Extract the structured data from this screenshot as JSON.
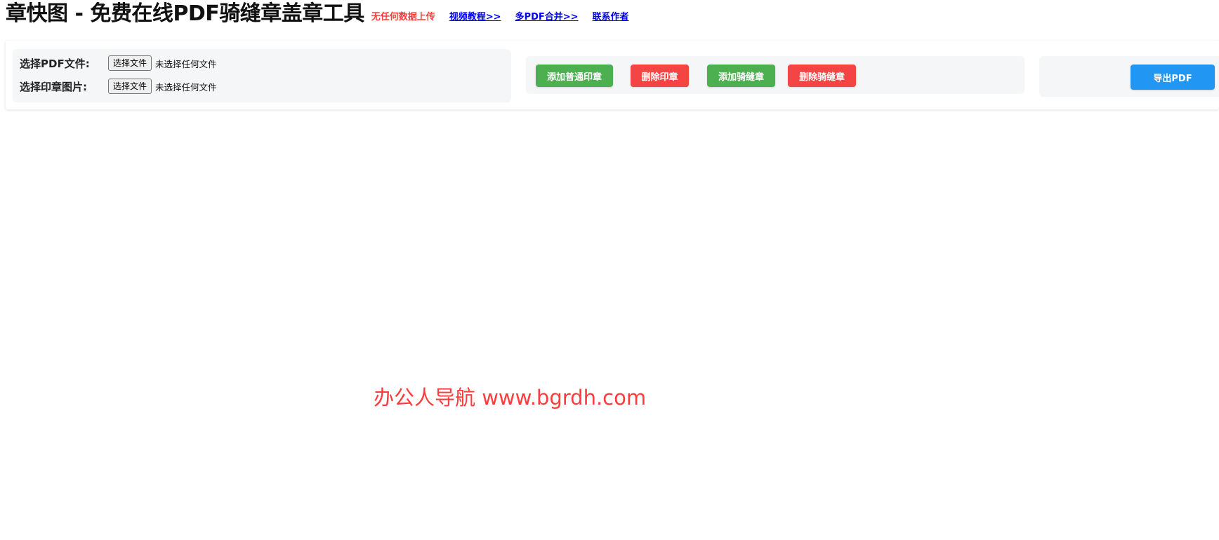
{
  "header": {
    "title": "章快图 - 免费在线PDF骑缝章盖章工具",
    "privacy_note": "无任何数据上传",
    "links": [
      {
        "label": "视频教程>>"
      },
      {
        "label": "多PDF合并>>"
      },
      {
        "label": "联系作者"
      }
    ]
  },
  "files": {
    "pdf": {
      "label": "选择PDF文件:",
      "button": "选择文件",
      "status": "未选择任何文件"
    },
    "stamp": {
      "label": "选择印章图片:",
      "button": "选择文件",
      "status": "未选择任何文件"
    }
  },
  "actions": {
    "add_stamp": "添加普通印章",
    "delete_stamp": "删除印章",
    "add_seam_stamp": "添加骑缝章",
    "delete_seam_stamp": "删除骑缝章"
  },
  "export": {
    "label": "导出PDF"
  },
  "watermark": "办公人导航 www.bgrdh.com",
  "colors": {
    "green": "#4caf50",
    "red": "#f44444",
    "blue": "#2196f3",
    "link": "#0000ee",
    "note_red": "#ff3b3b"
  }
}
